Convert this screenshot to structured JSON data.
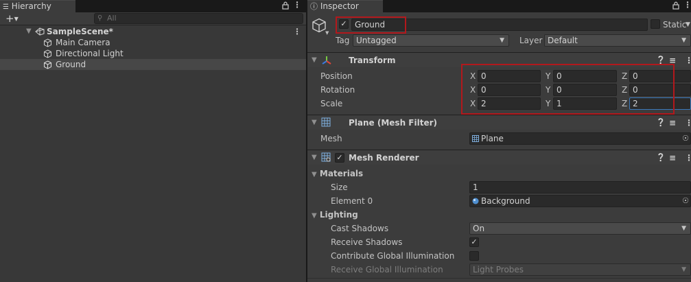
{
  "hierarchy": {
    "tab_label": "Hierarchy",
    "search_placeholder": "All",
    "scene_name": "SampleScene*",
    "objects": [
      "Main Camera",
      "Directional Light",
      "Ground"
    ],
    "selected_object": "Ground"
  },
  "inspector": {
    "tab_label": "Inspector",
    "object_name": "Ground",
    "active": true,
    "static_label": "Static",
    "tag_label": "Tag",
    "tag_value": "Untagged",
    "layer_label": "Layer",
    "layer_value": "Default",
    "transform": {
      "title": "Transform",
      "position_label": "Position",
      "rotation_label": "Rotation",
      "scale_label": "Scale",
      "axis_x": "X",
      "axis_y": "Y",
      "axis_z": "Z",
      "position": [
        "0",
        "0",
        "0"
      ],
      "rotation": [
        "0",
        "0",
        "0"
      ],
      "scale": [
        "2",
        "1",
        "2"
      ]
    },
    "mesh_filter": {
      "title": "Plane (Mesh Filter)",
      "mesh_label": "Mesh",
      "mesh_value": "Plane"
    },
    "mesh_renderer": {
      "title": "Mesh Renderer",
      "enabled": true,
      "materials_label": "Materials",
      "size_label": "Size",
      "size_value": "1",
      "element0_label": "Element 0",
      "element0_value": "Background",
      "lighting_label": "Lighting",
      "cast_shadows_label": "Cast Shadows",
      "cast_shadows_value": "On",
      "receive_shadows_label": "Receive Shadows",
      "receive_shadows": true,
      "contribute_gi_label": "Contribute Global Illumination",
      "contribute_gi": false,
      "receive_gi_label": "Receive Global Illumination",
      "receive_gi_value": "Light Probes"
    }
  },
  "colors": {
    "highlight_border": "#b3181c",
    "panel_bg": "#3c3c3c",
    "field_bg": "#2a2a2a"
  }
}
